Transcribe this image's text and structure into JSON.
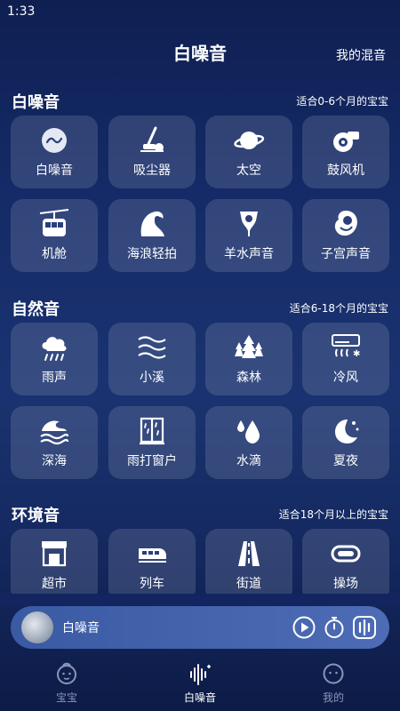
{
  "status": {
    "time": "1:33"
  },
  "header": {
    "title": "白噪音",
    "my_mix": "我的混音"
  },
  "sections": [
    {
      "title": "白噪音",
      "note": "适合0-6个月的宝宝",
      "items": [
        {
          "label": "白噪音",
          "icon": "wave-icon"
        },
        {
          "label": "吸尘器",
          "icon": "vacuum-icon"
        },
        {
          "label": "太空",
          "icon": "planet-icon"
        },
        {
          "label": "鼓风机",
          "icon": "blower-icon"
        },
        {
          "label": "机舱",
          "icon": "cable-car-icon"
        },
        {
          "label": "海浪轻拍",
          "icon": "ocean-wave-icon"
        },
        {
          "label": "羊水声音",
          "icon": "amniotic-icon"
        },
        {
          "label": "子宫声音",
          "icon": "womb-icon"
        }
      ]
    },
    {
      "title": "自然音",
      "note": "适合6-18个月的宝宝",
      "items": [
        {
          "label": "雨声",
          "icon": "rain-cloud-icon"
        },
        {
          "label": "小溪",
          "icon": "stream-icon"
        },
        {
          "label": "森林",
          "icon": "forest-icon"
        },
        {
          "label": "冷风",
          "icon": "air-conditioner-icon"
        },
        {
          "label": "深海",
          "icon": "deep-sea-icon"
        },
        {
          "label": "雨打窗户",
          "icon": "rain-window-icon"
        },
        {
          "label": "水滴",
          "icon": "water-drop-icon"
        },
        {
          "label": "夏夜",
          "icon": "moon-stars-icon"
        }
      ]
    },
    {
      "title": "环境音",
      "note": "适合18个月以上的宝宝",
      "items": [
        {
          "label": "超市",
          "icon": "supermarket-icon"
        },
        {
          "label": "列车",
          "icon": "train-icon"
        },
        {
          "label": "街道",
          "icon": "street-icon"
        },
        {
          "label": "操场",
          "icon": "playground-icon"
        }
      ]
    }
  ],
  "player": {
    "title": "白噪音"
  },
  "tabs": [
    {
      "label": "宝宝",
      "icon": "baby-face-icon",
      "active": false
    },
    {
      "label": "白噪音",
      "icon": "sound-wave-icon",
      "active": true
    },
    {
      "label": "我的",
      "icon": "profile-face-icon",
      "active": false
    }
  ],
  "colors": {
    "bg_top": "#0f1f52",
    "tile_bg": "rgba(255,255,255,0.13)",
    "player_bg": "#4d6cb5",
    "tab_active": "#ffffff",
    "tab_inactive": "#8a95b8"
  }
}
